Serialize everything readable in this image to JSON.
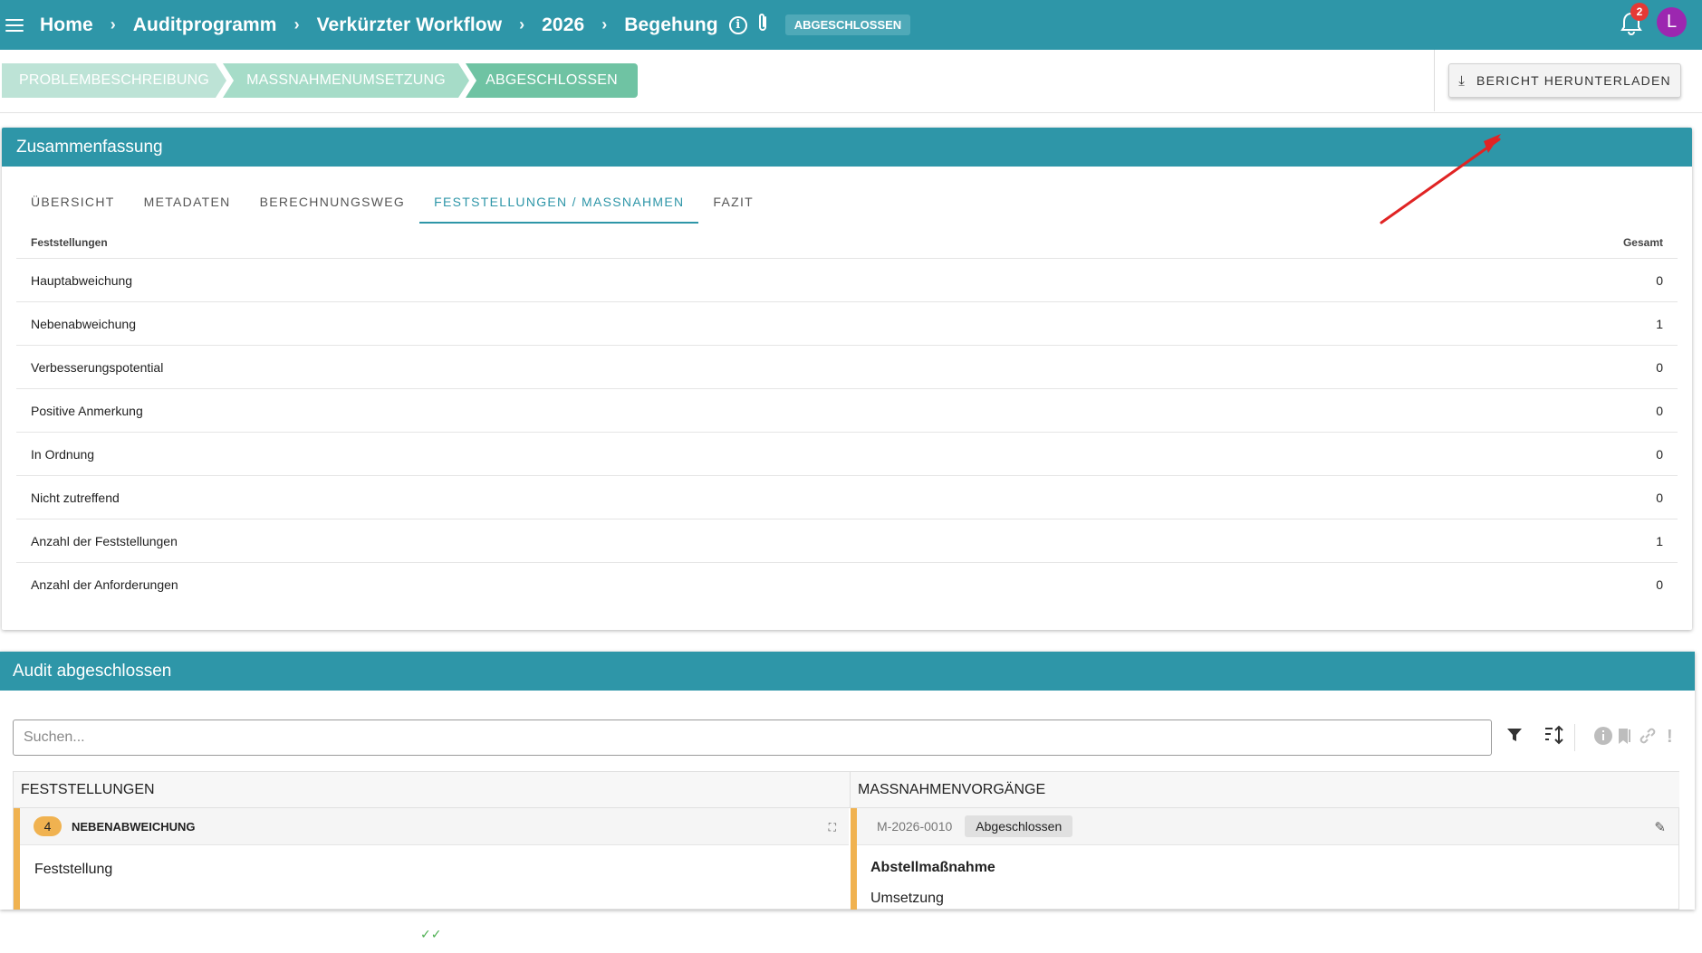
{
  "breadcrumb": [
    "Home",
    "Auditprogramm",
    "Verkürzter Workflow",
    "2026",
    "Begehung"
  ],
  "status_chip": "ABGESCHLOSSEN",
  "notifications_count": "2",
  "avatar_initial": "L",
  "stepper": {
    "steps": [
      "PROBLEMBESCHREIBUNG",
      "MASSNAHMENUMSETZUNG",
      "ABGESCHLOSSEN"
    ],
    "active_index": 2
  },
  "download_button": "BERICHT HERUNTERLADEN",
  "summary": {
    "title": "Zusammenfassung",
    "tabs": [
      "ÜBERSICHT",
      "METADATEN",
      "BERECHNUNGSWEG",
      "FESTSTELLUNGEN / MASSNAHMEN",
      "FAZIT"
    ],
    "active_tab": "FESTSTELLUNGEN / MASSNAHMEN",
    "table": {
      "header_left": "Feststellungen",
      "header_right": "Gesamt",
      "rows": [
        {
          "label": "Hauptabweichung",
          "value": "0"
        },
        {
          "label": "Nebenabweichung",
          "value": "1"
        },
        {
          "label": "Verbesserungspotential",
          "value": "0"
        },
        {
          "label": "Positive Anmerkung",
          "value": "0"
        },
        {
          "label": "In Ordnung",
          "value": "0"
        },
        {
          "label": "Nicht zutreffend",
          "value": "0"
        },
        {
          "label": "Anzahl der Feststellungen",
          "value": "1"
        },
        {
          "label": "Anzahl der Anforderungen",
          "value": "0"
        }
      ]
    }
  },
  "audit": {
    "title": "Audit abgeschlossen",
    "search_placeholder": "Suchen...",
    "columns": {
      "left": "FESTSTELLUNGEN",
      "right": "MASSNAHMENVORGÄNGE"
    },
    "finding": {
      "number": "4",
      "type": "NEBENABWEICHUNG",
      "body": "Feststellung"
    },
    "measure": {
      "id": "M-2026-0010",
      "status": "Abgeschlossen",
      "title": "Abstellmaßnahme",
      "subtitle": "Umsetzung"
    }
  },
  "colors": {
    "header": "#2e96a8",
    "step_active": "#6fc3a3",
    "badge": "#f0b250",
    "notification": "#e53935",
    "avatar": "#9c27b0",
    "arrow": "#e02424"
  }
}
